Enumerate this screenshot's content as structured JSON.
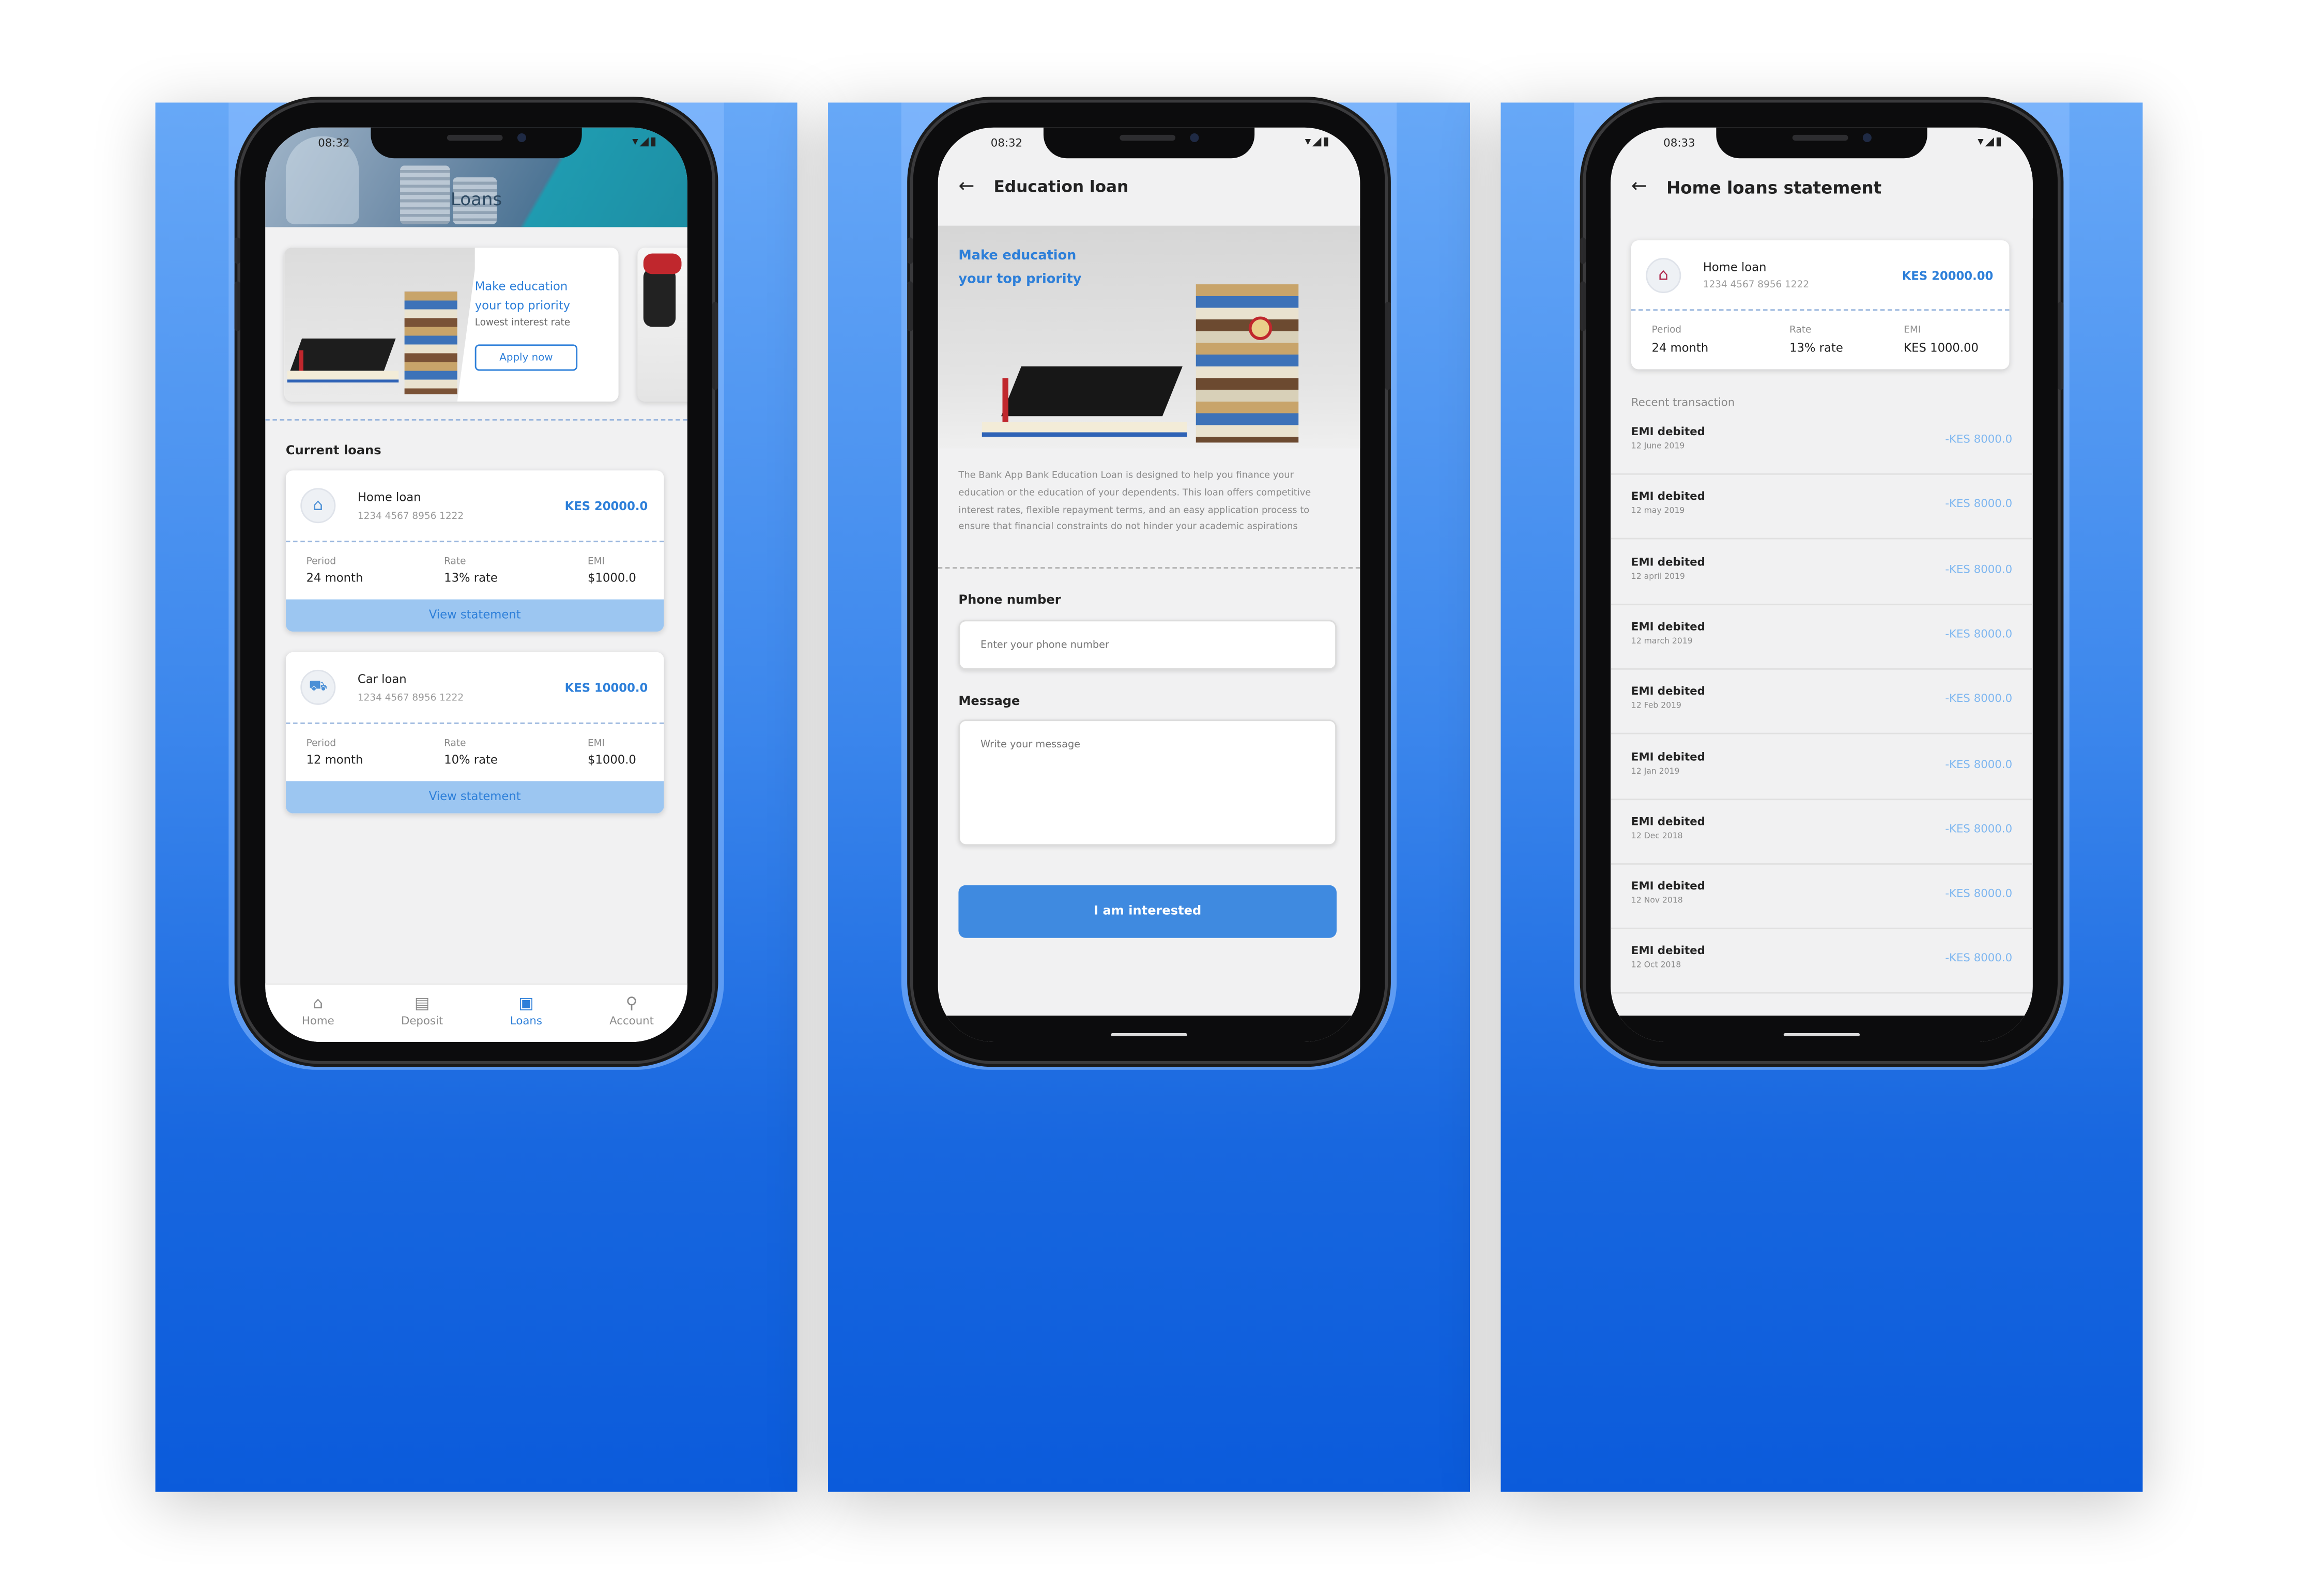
{
  "screens": {
    "loans": {
      "status_time": "08:32",
      "title": "Loans",
      "promo": {
        "heading1": "Make education",
        "heading2": "your top priority",
        "sub": "Lowest interest rate",
        "button": "Apply now"
      },
      "section_title": "Current loans",
      "loans": [
        {
          "name": "Home loan",
          "number": "1234 4567 8956 1222",
          "amount": "KES 20000.0",
          "period_label": "Period",
          "period": "24 month",
          "rate_label": "Rate",
          "rate": "13% rate",
          "emi_label": "EMI",
          "emi": "$1000.0",
          "action": "View statement",
          "icon": "home-lock-icon"
        },
        {
          "name": "Car loan",
          "number": "1234 4567 8956 1222",
          "amount": "KES 10000.0",
          "period_label": "Period",
          "period": "12 month",
          "rate_label": "Rate",
          "rate": "10% rate",
          "emi_label": "EMI",
          "emi": "$1000.0",
          "action": "View statement",
          "icon": "car-icon"
        }
      ],
      "nav": [
        {
          "label": "Home",
          "icon": "home-icon",
          "active": false
        },
        {
          "label": "Deposit",
          "icon": "deposit-icon",
          "active": false
        },
        {
          "label": "Loans",
          "icon": "loans-icon",
          "active": true
        },
        {
          "label": "Account",
          "icon": "account-icon",
          "active": false
        }
      ]
    },
    "education": {
      "status_time": "08:32",
      "title": "Education loan",
      "hero": {
        "line1": "Make education",
        "line2": "your top priority"
      },
      "description": "The Bank App Bank Education Loan is designed to help you finance your education or the education of your dependents. This loan offers competitive interest rates, flexible repayment terms, and an easy application process to ensure that financial constraints do not hinder your academic aspirations",
      "phone_label": "Phone number",
      "phone_placeholder": "Enter your phone number",
      "message_label": "Message",
      "message_placeholder": "Write your message",
      "submit": "I am interested"
    },
    "statement": {
      "status_time": "08:33",
      "title": "Home loans statement",
      "loan": {
        "name": "Home loan",
        "number": "1234 4567 8956 1222",
        "amount": "KES 20000.00",
        "period_label": "Period",
        "period": "24 month",
        "rate_label": "Rate",
        "rate": "13% rate",
        "emi_label": "EMI",
        "emi": "KES 1000.00"
      },
      "recent_label": "Recent transaction",
      "transactions": [
        {
          "title": "EMI debited",
          "date": "12 June 2019",
          "amount": "-KES 8000.0"
        },
        {
          "title": "EMI debited",
          "date": "12 may 2019",
          "amount": "-KES 8000.0"
        },
        {
          "title": "EMI debited",
          "date": "12 april 2019",
          "amount": "-KES 8000.0"
        },
        {
          "title": "EMI debited",
          "date": "12 march 2019",
          "amount": "-KES 8000.0"
        },
        {
          "title": "EMI debited",
          "date": "12 Feb 2019",
          "amount": "-KES 8000.0"
        },
        {
          "title": "EMI debited",
          "date": "12 Jan 2019",
          "amount": "-KES 8000.0"
        },
        {
          "title": "EMI debited",
          "date": "12 Dec 2018",
          "amount": "-KES 8000.0"
        },
        {
          "title": "EMI debited",
          "date": "12 Nov 2018",
          "amount": "-KES 8000.0"
        },
        {
          "title": "EMI debited",
          "date": "12 Oct 2018",
          "amount": "-KES 8000.0"
        }
      ]
    }
  },
  "colors": {
    "accent": "#2d7fd9",
    "button": "#3f8ae0",
    "view_statement_bg": "#9cc6f1",
    "panel_top": "#67a8f7",
    "panel_bottom": "#0b5bdb"
  }
}
